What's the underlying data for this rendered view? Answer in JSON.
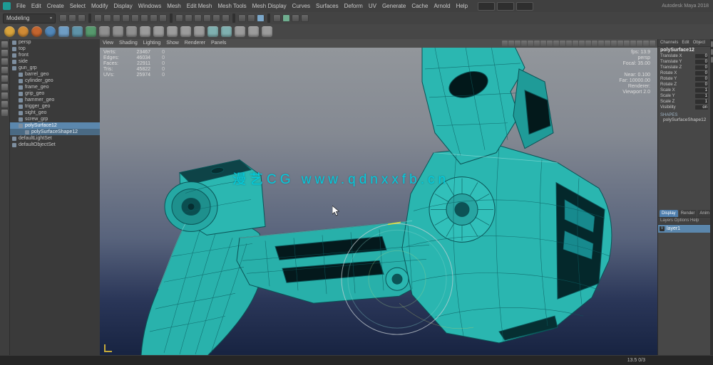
{
  "window": {
    "brand": "Autodesk Maya 2018"
  },
  "menu_bar": {
    "items": [
      "File",
      "Edit",
      "Create",
      "Select",
      "Modify",
      "Display",
      "Windows",
      "Mesh",
      "Edit Mesh",
      "Mesh Tools",
      "Mesh Display",
      "Curves",
      "Surfaces",
      "Deform",
      "UV",
      "Generate",
      "Cache",
      "Arnold",
      "Help"
    ],
    "quick_buttons": [
      "workspace-modeling-button",
      "workspace-sculpting-button",
      "workspace-uv-button"
    ]
  },
  "status_line": {
    "menu_set": "Modeling",
    "icons": [
      {
        "icon": "hierarchy-mode-icon"
      },
      {
        "icon": "object-mode-icon"
      },
      {
        "icon": "component-mode-icon"
      },
      {
        "sep": true
      },
      {
        "icon": "select-handles-icon"
      },
      {
        "icon": "select-joints-icon"
      },
      {
        "icon": "select-curves-icon"
      },
      {
        "icon": "select-surfaces-icon"
      },
      {
        "icon": "select-deformations-icon"
      },
      {
        "icon": "select-dynamics-icon"
      },
      {
        "icon": "select-rendering-icon"
      },
      {
        "icon": "select-misc-icon"
      },
      {
        "sep": true
      },
      {
        "icon": "snap-grid-icon"
      },
      {
        "icon": "snap-curve-icon"
      },
      {
        "icon": "snap-point-icon"
      },
      {
        "icon": "snap-projected-icon"
      },
      {
        "icon": "snap-viewplane-icon"
      },
      {
        "icon": "make-live-icon"
      },
      {
        "sep": true
      },
      {
        "icon": "input-connections-icon"
      },
      {
        "icon": "output-connections-icon"
      },
      {
        "icon": "history-toggle-icon",
        "color": "#7ba7c9"
      },
      {
        "sep": true
      },
      {
        "icon": "open-render-view-icon"
      },
      {
        "icon": "render-current-icon",
        "color": "#6fae8f"
      },
      {
        "icon": "ipr-render-icon"
      },
      {
        "icon": "render-settings-icon"
      }
    ]
  },
  "shelf": {
    "icons": [
      {
        "name": "nurbs-circle-icon",
        "color": "#d9a43c",
        "shape": "circle"
      },
      {
        "name": "nurbs-square-icon",
        "color": "#cf8a35",
        "shape": "circle"
      },
      {
        "name": "nurbs-sphere-icon",
        "color": "#c4652f",
        "shape": "circle"
      },
      {
        "name": "poly-sphere-icon",
        "color": "#5187b9",
        "shape": "circle"
      },
      {
        "name": "poly-cube-icon",
        "color": "#6f9dc4",
        "shape": "square"
      },
      {
        "name": "poly-cylinder-icon",
        "color": "#5e93a8",
        "shape": "square"
      },
      {
        "name": "poly-cone-icon",
        "color": "#56996d",
        "shape": "square"
      },
      {
        "name": "poly-torus-icon",
        "color": "#8f8f8f",
        "shape": "square"
      },
      {
        "name": "poly-plane-icon",
        "color": "#8f8f8f",
        "shape": "square"
      },
      {
        "name": "platonic-solid-icon",
        "color": "#8f8f8f",
        "shape": "square"
      },
      {
        "name": "bevel-icon",
        "color": "#9b9b9b",
        "shape": "square"
      },
      {
        "name": "extrude-icon",
        "color": "#9b9b9b",
        "shape": "square"
      },
      {
        "name": "bridge-icon",
        "color": "#9b9b9b",
        "shape": "square"
      },
      {
        "name": "multi-cut-icon",
        "color": "#9b9b9b",
        "shape": "square"
      },
      {
        "name": "target-weld-icon",
        "color": "#9b9b9b",
        "shape": "square"
      },
      {
        "name": "smooth-icon",
        "color": "#7fb0b0",
        "shape": "square"
      },
      {
        "name": "mirror-icon",
        "color": "#7fb0b0",
        "shape": "square"
      },
      {
        "name": "combine-icon",
        "color": "#9b9b9b",
        "shape": "square"
      },
      {
        "name": "separate-icon",
        "color": "#9b9b9b",
        "shape": "square"
      },
      {
        "name": "boolean-icon",
        "color": "#9b9b9b",
        "shape": "square"
      }
    ]
  },
  "toolbox": {
    "tools": [
      "select-tool",
      "lasso-select-tool",
      "paint-select-tool",
      "move-tool",
      "rotate-tool",
      "scale-tool",
      "last-tool-used",
      "single-pane-layout",
      "four-pane-layout"
    ]
  },
  "outliner": {
    "items": [
      {
        "label": "persp",
        "depth": 0
      },
      {
        "label": "top",
        "depth": 0
      },
      {
        "label": "front",
        "depth": 0
      },
      {
        "label": "side",
        "depth": 0
      },
      {
        "label": "gun_grp",
        "depth": 0
      },
      {
        "label": "barrel_geo",
        "depth": 1
      },
      {
        "label": "cylinder_geo",
        "depth": 1
      },
      {
        "label": "frame_geo",
        "depth": 1
      },
      {
        "label": "grip_geo",
        "depth": 1
      },
      {
        "label": "hammer_geo",
        "depth": 1
      },
      {
        "label": "trigger_geo",
        "depth": 1
      },
      {
        "label": "sight_geo",
        "depth": 1
      },
      {
        "label": "screw_grp",
        "depth": 1
      },
      {
        "label": "polySurface12",
        "depth": 1,
        "selected": true
      },
      {
        "label": "polySurfaceShape12",
        "depth": 2,
        "highlight": true
      },
      {
        "label": "defaultLightSet",
        "depth": 0
      },
      {
        "label": "defaultObjectSet",
        "depth": 0
      }
    ]
  },
  "viewport": {
    "panel_menus": [
      "View",
      "Shading",
      "Lighting",
      "Show",
      "Renderer",
      "Panels"
    ],
    "toolbar_icons": [
      "select-camera-icon",
      "lock-camera-icon",
      "camera-attributes-icon",
      "bookmarks-icon",
      "image-plane-icon",
      "2d-pan-zoom-icon",
      "grease-pencil-icon",
      "grid-icon",
      "film-gate-icon",
      "resolution-gate-icon",
      "gate-mask-icon",
      "field-chart-icon",
      "safe-action-icon",
      "safe-title-icon",
      "fill-mode-icon",
      "wireframe-on-shaded-icon",
      "textured-icon",
      "use-default-material-icon",
      "lighting-icon",
      "shadows-icon",
      "occlusion-icon",
      "anti-alias-icon",
      "xray-icon",
      "isolate-select-icon"
    ],
    "hud": {
      "left_rows": [
        {
          "label": "Verts:",
          "total": "23467",
          "selected": "0"
        },
        {
          "label": "Edges:",
          "total": "46034",
          "selected": "0"
        },
        {
          "label": "Faces:",
          "total": "22911",
          "selected": "0"
        },
        {
          "label": "Tris:",
          "total": "45822",
          "selected": "0"
        },
        {
          "label": "UVs:",
          "total": "25974",
          "selected": "0"
        }
      ],
      "right_top": [
        "fps: 13.9",
        "persp",
        "Focal: 35.00"
      ],
      "right_bottom": [
        "Near: 0.100",
        "Far: 10000.00",
        "Renderer:",
        "Viewport 2.0"
      ]
    },
    "watermark": "漫艺CG www.qdnxxfb.cn"
  },
  "channel_box": {
    "menus": [
      "Channels",
      "Edit",
      "Object"
    ],
    "object_name": "polySurface12",
    "attributes": [
      {
        "name": "Translate X",
        "value": "0"
      },
      {
        "name": "Translate Y",
        "value": "0"
      },
      {
        "name": "Translate Z",
        "value": "0"
      },
      {
        "name": "Rotate X",
        "value": "0"
      },
      {
        "name": "Rotate Y",
        "value": "0"
      },
      {
        "name": "Rotate Z",
        "value": "0"
      },
      {
        "name": "Scale X",
        "value": "1"
      },
      {
        "name": "Scale Y",
        "value": "1"
      },
      {
        "name": "Scale Z",
        "value": "1"
      },
      {
        "name": "Visibility",
        "value": "on"
      }
    ],
    "shapes_label": "SHAPES",
    "shape_name": "polySurfaceShape12"
  },
  "layers": {
    "tabs": [
      {
        "label": "Display",
        "selected": true
      },
      {
        "label": "Render"
      },
      {
        "label": "Anim"
      }
    ],
    "menu": "Layers  Options  Help",
    "items": [
      {
        "name": "layer1",
        "selected": true
      }
    ]
  },
  "right_edge": {
    "tabs": [
      "channel-box-tab-icon",
      "attribute-editor-tab-icon",
      "tool-settings-tab-icon"
    ]
  },
  "timeline": {
    "frame_info": "13.5 0/3"
  },
  "colors": {
    "model_teal": "#2ab6b0",
    "watermark_cyan": "#00cfe0",
    "selection_blue": "#5b87ad",
    "viewport_top": "#8f9398",
    "viewport_bottom": "#172341"
  }
}
